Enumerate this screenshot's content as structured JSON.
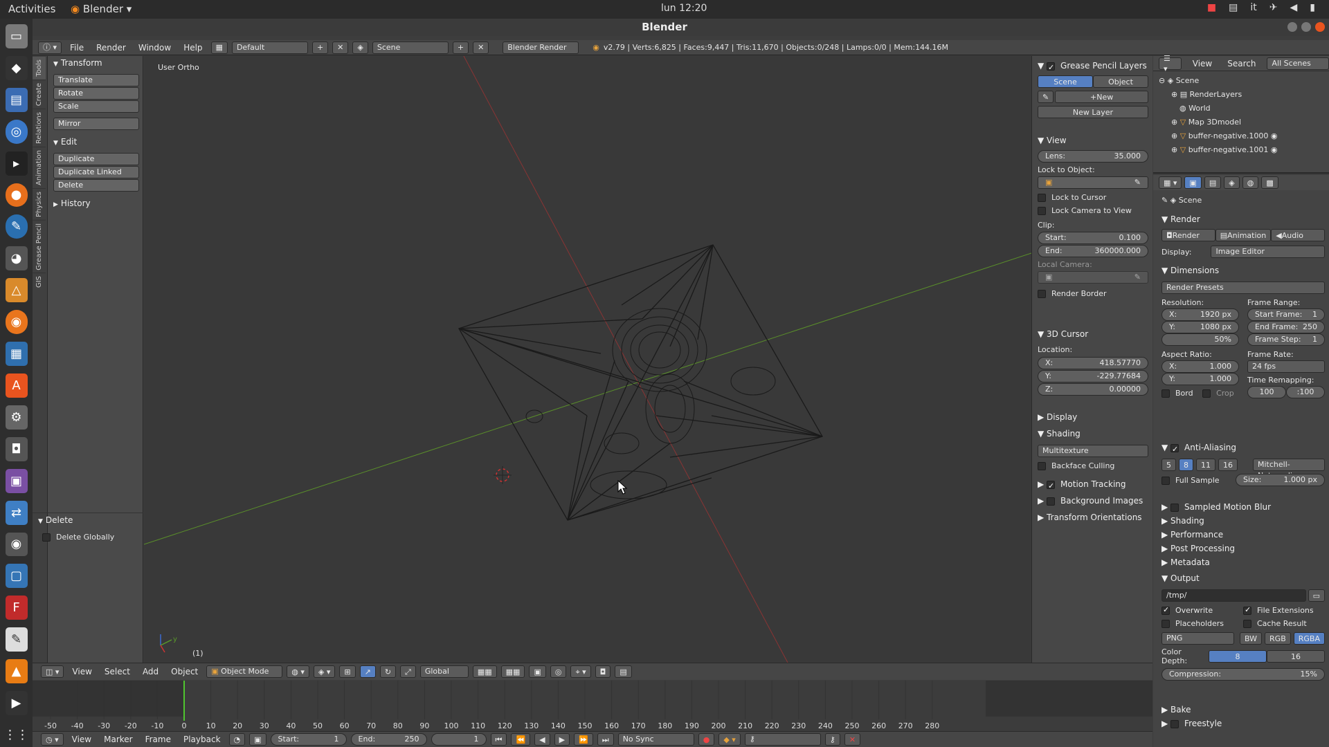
{
  "topbar": {
    "activities": "Activities",
    "app_name": "Blender",
    "clock": "lun 12:20",
    "lang": "it"
  },
  "window": {
    "title": "Blender"
  },
  "info_header": {
    "menus": [
      "File",
      "Render",
      "Window",
      "Help"
    ],
    "layout": "Default",
    "scene": "Scene",
    "engine": "Blender Render",
    "stats": "v2.79 | Verts:6,825 | Faces:9,447 | Tris:11,670 | Objects:0/248 | Lamps:0/0 | Mem:144.16M"
  },
  "toolshelf": {
    "tabs": [
      "Tools",
      "Create",
      "Relations",
      "Animation",
      "Physics",
      "Grease Pencil",
      "GIS"
    ],
    "transform": {
      "title": "Transform",
      "translate": "Translate",
      "rotate": "Rotate",
      "scale": "Scale",
      "mirror": "Mirror"
    },
    "edit": {
      "title": "Edit",
      "duplicate": "Duplicate",
      "duplicate_linked": "Duplicate Linked",
      "delete": "Delete"
    },
    "history": {
      "title": "History"
    },
    "delete_panel": {
      "title": "Delete",
      "delete_globally": "Delete Globally"
    }
  },
  "viewport": {
    "label": "User Ortho",
    "frame": "(1)"
  },
  "npanel": {
    "grease": {
      "title": "Grease Pencil Layers",
      "scene": "Scene",
      "object": "Object",
      "new": "New",
      "new_layer": "New Layer"
    },
    "view": {
      "title": "View",
      "lens_label": "Lens:",
      "lens": "35.000",
      "lock_to_object": "Lock to Object:",
      "lock_cursor": "Lock to Cursor",
      "lock_camera": "Lock Camera to View",
      "clip": "Clip:",
      "start_label": "Start:",
      "start": "0.100",
      "end_label": "End:",
      "end": "360000.000",
      "local_camera": "Local Camera:",
      "render_border": "Render Border"
    },
    "cursor": {
      "title": "3D Cursor",
      "location": "Location:",
      "x_label": "X:",
      "x": "418.57770",
      "y_label": "Y:",
      "y": "-229.77684",
      "z_label": "Z:",
      "z": "0.00000"
    },
    "display": {
      "title": "Display"
    },
    "shading": {
      "title": "Shading",
      "mode": "Multitexture",
      "backface": "Backface Culling"
    },
    "motion_tracking": "Motion Tracking",
    "background_images": "Background Images",
    "transform_orientations": "Transform Orientations"
  },
  "outliner": {
    "menus": [
      "View",
      "Search"
    ],
    "filter": "All Scenes",
    "items": [
      "Scene",
      "RenderLayers",
      "World",
      "Map 3Dmodel",
      "buffer-negative.1000",
      "buffer-negative.1001"
    ]
  },
  "properties": {
    "context": "Scene",
    "render": {
      "title": "Render",
      "render": "Render",
      "animation": "Animation",
      "audio": "Audio",
      "display_label": "Display:",
      "display": "Image Editor"
    },
    "dimensions": {
      "title": "Dimensions",
      "presets": "Render Presets",
      "resolution": "Resolution:",
      "res_x": "1920 px",
      "res_y": "1080 px",
      "res_pct": "50%",
      "frame_range": "Frame Range:",
      "start_frame": "Start Frame:",
      "start_frame_val": "1",
      "end_frame": "End Frame:",
      "end_frame_val": "250",
      "frame_step": "Frame Step:",
      "frame_step_val": "1",
      "aspect": "Aspect Ratio:",
      "asp_x": "1.000",
      "asp_y": "1.000",
      "frame_rate": "Frame Rate:",
      "fps": "24 fps",
      "time_remap": "Time Remapping:",
      "remap_old": "100",
      "remap_new": ":100",
      "bord": "Bord",
      "crop": "Crop"
    },
    "aa": {
      "title": "Anti-Aliasing",
      "samples": [
        "5",
        "8",
        "11",
        "16"
      ],
      "filter": "Mitchell-Netravali",
      "full_sample": "Full Sample",
      "size": "Size:",
      "size_val": "1.000 px"
    },
    "collapsed": [
      "Sampled Motion Blur",
      "Shading",
      "Performance",
      "Post Processing",
      "Metadata"
    ],
    "output": {
      "title": "Output",
      "path": "/tmp/",
      "overwrite": "Overwrite",
      "file_ext": "File Extensions",
      "placeholders": "Placeholders",
      "cache": "Cache Result",
      "format": "PNG",
      "bw": "BW",
      "rgb": "RGB",
      "rgba": "RGBA",
      "depth_label": "Color Depth:",
      "depth_8": "8",
      "depth_16": "16",
      "compression": "Compression:",
      "compression_val": "15%"
    },
    "bake": "Bake",
    "freestyle": "Freestyle"
  },
  "view3d_header": {
    "menus": [
      "View",
      "Select",
      "Add",
      "Object"
    ],
    "mode": "Object Mode",
    "orientation": "Global"
  },
  "timeline": {
    "ruler": [
      "-50",
      "-40",
      "-30",
      "-20",
      "-10",
      "0",
      "10",
      "20",
      "30",
      "40",
      "50",
      "60",
      "70",
      "80",
      "90",
      "100",
      "110",
      "120",
      "130",
      "140",
      "150",
      "160",
      "170",
      "180",
      "190",
      "200",
      "210",
      "220",
      "230",
      "240",
      "250",
      "260",
      "270",
      "280"
    ],
    "current_frame": 0,
    "menus": [
      "View",
      "Marker",
      "Frame",
      "Playback"
    ],
    "start_label": "Start:",
    "start": "1",
    "end_label": "End:",
    "end": "250",
    "frame": "1",
    "sync": "No Sync"
  }
}
